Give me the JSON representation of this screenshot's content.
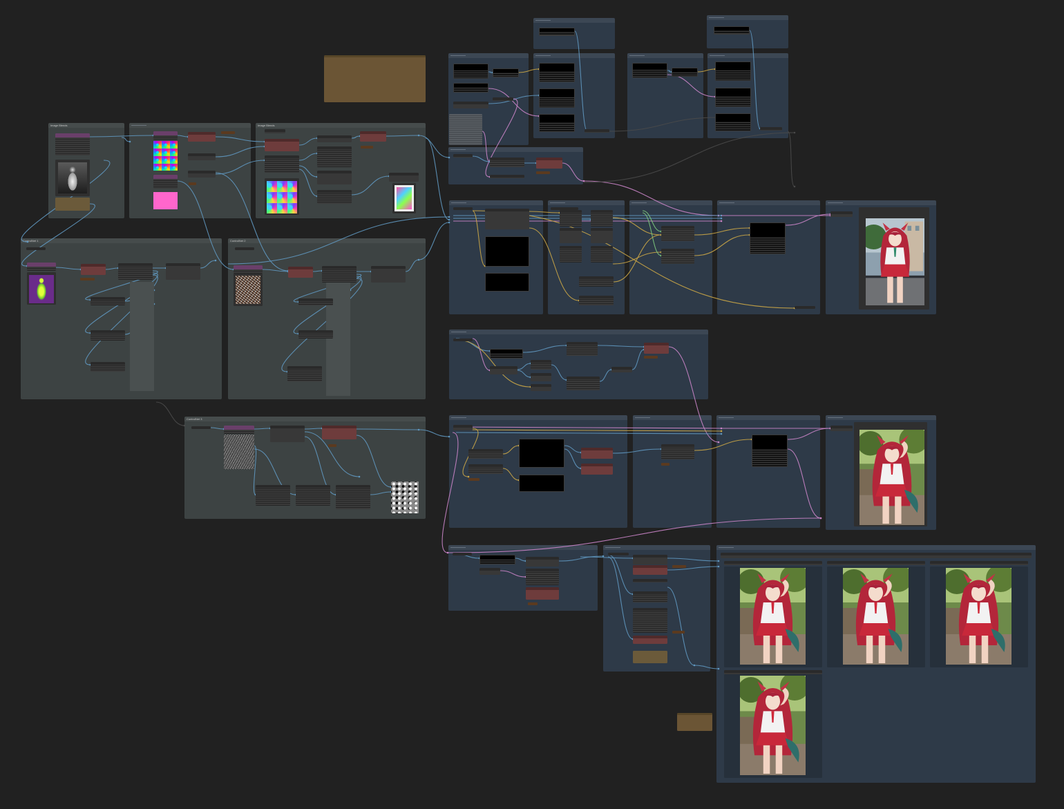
{
  "canvas": {
    "background": "#212121"
  },
  "colors": {
    "group_gray": "#3d4343",
    "group_blue": "#2e3a48",
    "note_brown": "#6b5535",
    "node": "#383838",
    "node_red": "#6e3c3c",
    "node_purple": "#6a3f6a",
    "wire_blue": "#5f97bf",
    "wire_pink": "#c984c6",
    "wire_yellow": "#c9a546",
    "wire_green": "#7cc67c",
    "wire_dim": "#4a4a4a"
  },
  "groups": {
    "image_blends_1": "Image Blends",
    "image_blends_2": "Image Blends",
    "controlnet_1": "ControlNet 1",
    "controlnet_2": "ControlNet 2",
    "controlnet_3": "ControlNet 3"
  }
}
